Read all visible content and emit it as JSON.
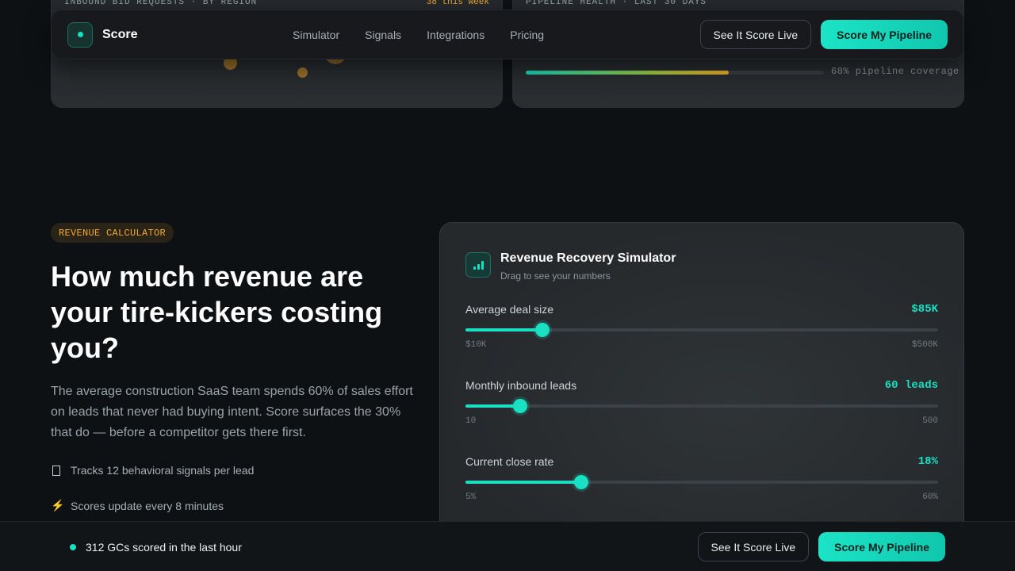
{
  "top_cards": {
    "left_caption": "INBOUND BID REQUESTS · BY REGION",
    "left_badge": "38 this week",
    "right_caption": "PIPELINE HEALTH · LAST 30 DAYS",
    "coverage_label": "68% pipeline coverage",
    "coverage_percent": 68
  },
  "nav": {
    "brand": "Score",
    "links": [
      "Simulator",
      "Signals",
      "Integrations",
      "Pricing"
    ],
    "secondary_cta": "See It Score Live",
    "primary_cta": "Score My Pipeline"
  },
  "hero": {
    "pill": "REVENUE CALCULATOR",
    "headline": "How much revenue are your tire-kickers costing you?",
    "description": "The average construction SaaS team spends 60% of sales effort on leads that never had buying intent. Score surfaces the 30% that do — before a competitor gets there first.",
    "features": [
      {
        "icon": "clipboard-icon",
        "text": "Tracks 12 behavioral signals per lead"
      },
      {
        "icon": "lightning-icon",
        "text": "Scores update every 8 minutes"
      }
    ]
  },
  "simulator": {
    "title": "Revenue Recovery Simulator",
    "subtitle": "Drag to see your numbers",
    "sliders": [
      {
        "label": "Average deal size",
        "value_text": "$85K",
        "min_text": "$10K",
        "max_text": "$500K",
        "fraction": 0.163
      },
      {
        "label": "Monthly inbound leads",
        "value_text": "60 leads",
        "min_text": "10",
        "max_text": "500",
        "fraction": 0.115
      },
      {
        "label": "Current close rate",
        "value_text": "18%",
        "min_text": "5%",
        "max_text": "60%",
        "fraction": 0.245
      }
    ]
  },
  "bottom_bar": {
    "live_text": "312 GCs scored in the last hour",
    "secondary_cta": "See It Score Live",
    "primary_cta": "Score My Pipeline"
  },
  "colors": {
    "accent": "#19e0c2",
    "amber": "#f0a830",
    "background": "#0e1114"
  }
}
